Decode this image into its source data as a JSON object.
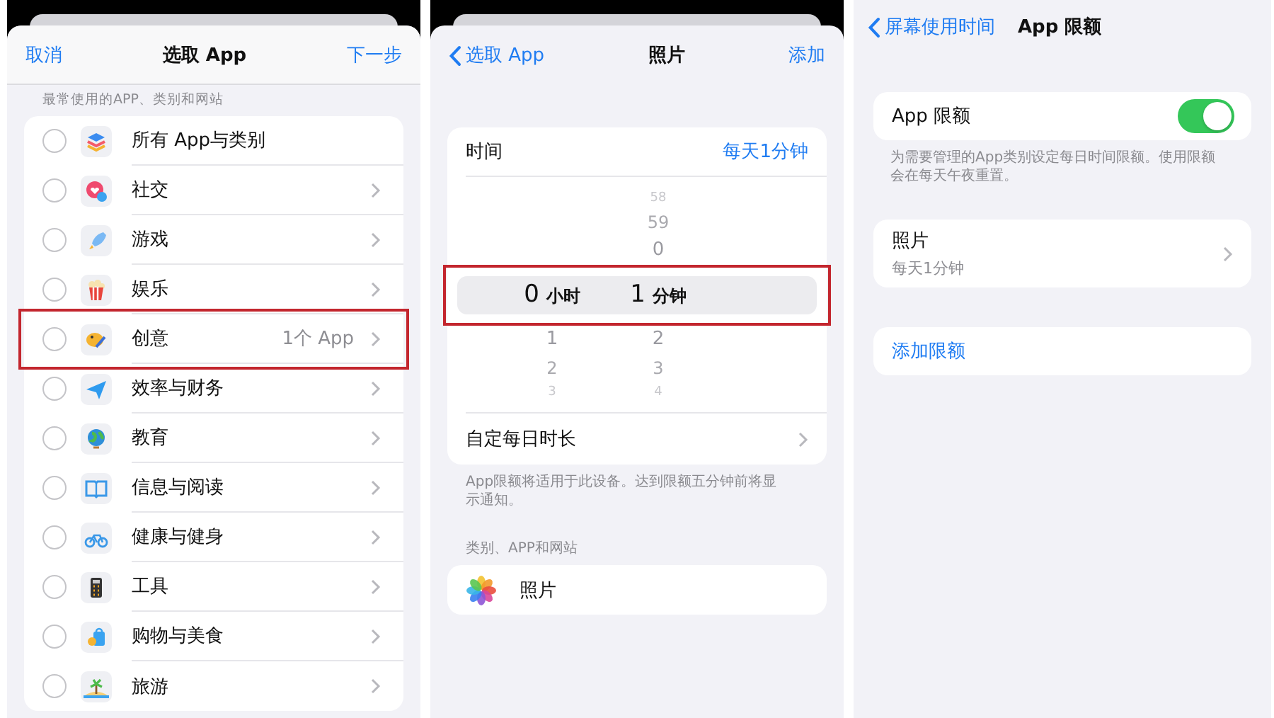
{
  "select_app": {
    "cancel": "取消",
    "title": "选取 App",
    "next": "下一步",
    "caption": "最常使用的APP、类别和网站",
    "items": [
      {
        "label": "所有 App与类别",
        "kind": "all",
        "checked": false,
        "highlighted": false
      },
      {
        "label": "社交",
        "kind": "category",
        "checked": false,
        "highlighted": false
      },
      {
        "label": "游戏",
        "kind": "category",
        "checked": false,
        "highlighted": false
      },
      {
        "label": "娱乐",
        "kind": "category",
        "checked": false,
        "highlighted": false
      },
      {
        "label": "创意",
        "kind": "category",
        "value": "1个 App",
        "checked": false,
        "highlighted": true
      },
      {
        "label": "效率与财务",
        "kind": "category",
        "checked": false,
        "highlighted": false
      },
      {
        "label": "教育",
        "kind": "category",
        "checked": false,
        "highlighted": false
      },
      {
        "label": "信息与阅读",
        "kind": "category",
        "checked": false,
        "highlighted": false
      },
      {
        "label": "健康与健身",
        "kind": "category",
        "checked": false,
        "highlighted": false
      },
      {
        "label": "工具",
        "kind": "category",
        "checked": false,
        "highlighted": false
      },
      {
        "label": "购物与美食",
        "kind": "category",
        "checked": false,
        "highlighted": false
      },
      {
        "label": "旅游",
        "kind": "category",
        "checked": false,
        "highlighted": false
      }
    ]
  },
  "limit_editor": {
    "back": "选取 App",
    "title": "照片",
    "add": "添加",
    "time_label": "时间",
    "time_value": "每天1分钟",
    "picker": {
      "highlighted": true,
      "columns": [
        {
          "value": "0",
          "unit": "小时",
          "below": [
            "1",
            "2",
            "3"
          ]
        },
        {
          "above": [
            "58",
            "59",
            "0"
          ],
          "value": "1",
          "unit": "分钟",
          "below": [
            "2",
            "3",
            "4"
          ]
        }
      ]
    },
    "custom_label": "自定每日时长",
    "note": "App限额将适用于此设备。达到限额五分钟前将显示通知。",
    "section": "类别、APP和网站",
    "apps": [
      {
        "label": "照片"
      }
    ]
  },
  "app_limits": {
    "back": "屏幕使用时间",
    "title": "App 限额",
    "toggle": {
      "label": "App 限额",
      "on": true
    },
    "note": "为需要管理的App类别设定每日时间限额。使用限额会在每天午夜重置。",
    "limits": [
      {
        "name": "照片",
        "detail": "每天1分钟"
      }
    ],
    "add": "添加限额"
  }
}
